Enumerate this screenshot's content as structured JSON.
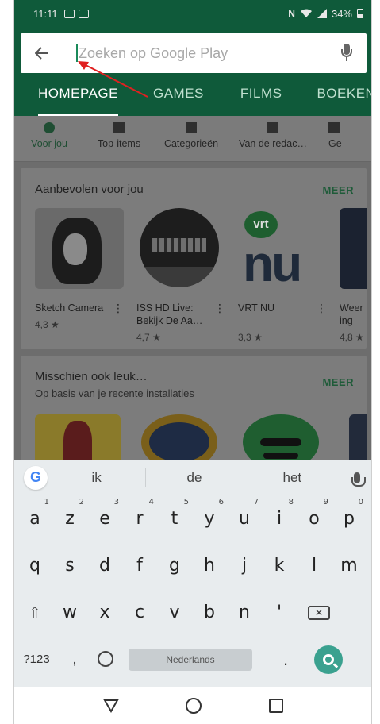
{
  "status": {
    "time": "11:11",
    "battery": "34%",
    "nfc": "N"
  },
  "search": {
    "placeholder": "Zoeken op Google Play",
    "value": ""
  },
  "tabs": [
    "HOMEPAGE",
    "GAMES",
    "FILMS",
    "BOEKEN"
  ],
  "subnav": [
    "Voor jou",
    "Top-items",
    "Categorieën",
    "Van de redac…",
    "Ge"
  ],
  "section1": {
    "title": "Aanbevolen voor jou",
    "more": "MEER",
    "apps": [
      {
        "name": "Sketch Camera",
        "rating": "4,3 ★"
      },
      {
        "name": "ISS HD Live: Bekijk De Aa…",
        "rating": "4,7 ★"
      },
      {
        "name": "VRT NU",
        "rating": "3,3 ★"
      },
      {
        "name": "Weer ing",
        "rating": "4,8 ★"
      }
    ],
    "vrt_logo": "vrt"
  },
  "section2": {
    "title": "Misschien ook leuk…",
    "subtitle": "Op basis van je recente installaties",
    "more": "MEER"
  },
  "keyboard": {
    "suggestions": [
      "ik",
      "de",
      "het"
    ],
    "row1": [
      "a",
      "z",
      "e",
      "r",
      "t",
      "y",
      "u",
      "i",
      "o",
      "p"
    ],
    "row1_hints": [
      "1",
      "2",
      "3",
      "4",
      "5",
      "6",
      "7",
      "8",
      "9",
      "0"
    ],
    "row2": [
      "q",
      "s",
      "d",
      "f",
      "g",
      "h",
      "j",
      "k",
      "l",
      "m"
    ],
    "row3": [
      "w",
      "x",
      "c",
      "v",
      "b",
      "n",
      "'"
    ],
    "symbols": "?123",
    "comma": ",",
    "space_label": "Nederlands",
    "period": "."
  },
  "colors": {
    "header": "#0f5a3a",
    "annotation": "#e02020",
    "search_key": "#3aa18f"
  }
}
